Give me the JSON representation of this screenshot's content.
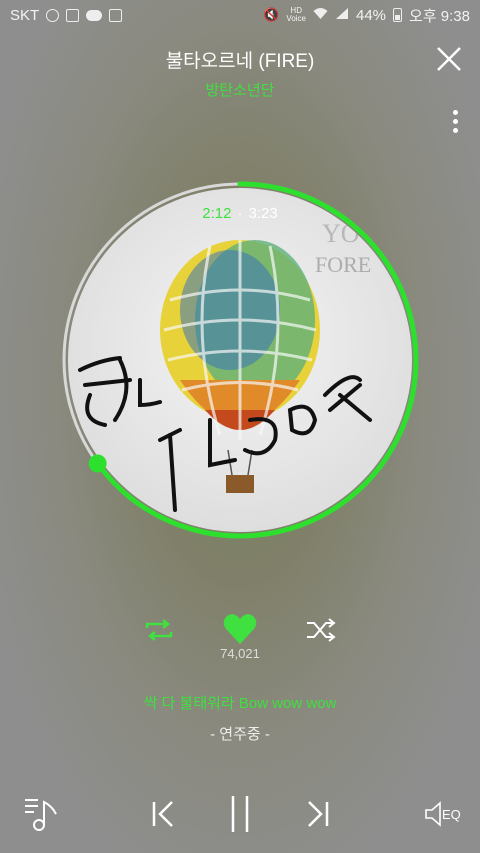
{
  "status_bar": {
    "carrier": "SKT",
    "hd_label": "HD",
    "voice_label": "Voice",
    "battery": "44%",
    "time": "오후 9:38"
  },
  "player": {
    "song_title": "불타오르네 (FIRE)",
    "artist": "방탄소년단",
    "elapsed": "2:12",
    "total": "3:23",
    "progress_fraction": 0.65,
    "like_count": "74,021",
    "lyric": "싹 다 불태워라 Bow wow wow",
    "playing_status": "- 연주중 -"
  },
  "colors": {
    "accent": "#3fe03f",
    "text": "#ffffff"
  },
  "icons": {
    "close": "close-icon",
    "more": "more-vertical-icon",
    "repeat": "repeat-icon",
    "like": "heart-icon",
    "shuffle": "shuffle-icon",
    "playlist": "playlist-icon",
    "previous": "previous-icon",
    "pause": "pause-icon",
    "next": "next-icon",
    "eq": "eq-icon"
  },
  "bottom_bar": {
    "eq_label": "EQ"
  }
}
